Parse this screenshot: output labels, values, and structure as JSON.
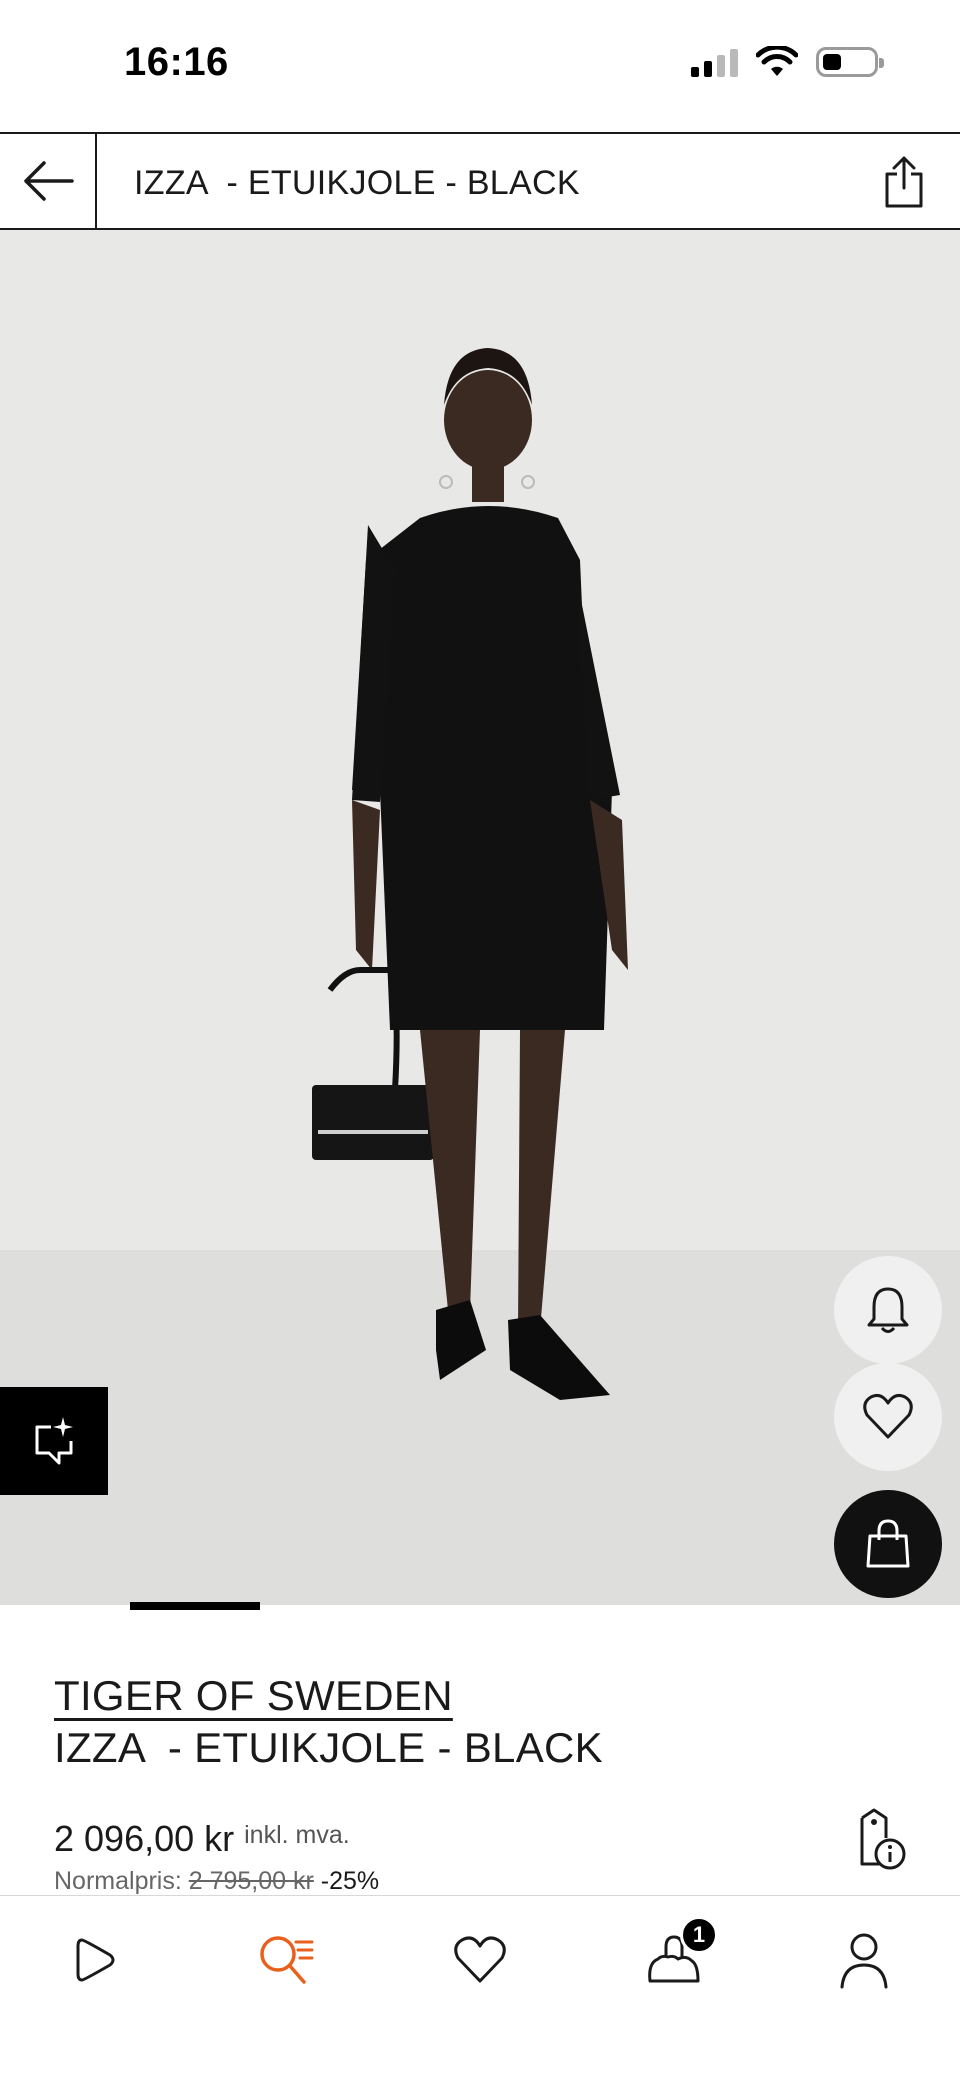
{
  "status_bar": {
    "time": "16:16",
    "icons": [
      "signal-icon",
      "wifi-icon",
      "battery-icon"
    ],
    "battery_level": 0.35
  },
  "header": {
    "back_icon": "arrow-left-icon",
    "title": "IZZA  - ETUIKJOLE - BLACK",
    "share_icon": "share-icon"
  },
  "product_image": {
    "alt": "IZZA  - ETUIKJOLE - BLACK",
    "carousel_position": 1,
    "carousel_total": 5,
    "actions": {
      "notify_icon": "bell-icon",
      "wishlist_icon": "heart-icon",
      "add_to_bag_icon": "shopping-bag-icon",
      "similar_icon": "similar-items-icon"
    }
  },
  "product": {
    "brand": "TIGER OF SWEDEN",
    "name": "IZZA  - ETUIKJOLE - BLACK",
    "price": "2 096,00 kr",
    "vat_note": "inkl. mva.",
    "normal_label": "Normalpris: ",
    "normal_price": "2 795,00 kr",
    "discount": " -25%",
    "price_info_icon": "price-tag-info-icon"
  },
  "bottom_nav": {
    "items": [
      {
        "icon": "play-icon",
        "name": "nav-play"
      },
      {
        "icon": "search-list-icon",
        "name": "nav-search",
        "active": true
      },
      {
        "icon": "heart-icon",
        "name": "nav-wishlist"
      },
      {
        "icon": "bag-icon",
        "name": "nav-bag",
        "badge": "1"
      },
      {
        "icon": "user-icon",
        "name": "nav-profile"
      }
    ]
  },
  "colors": {
    "accent": "#e8601c",
    "text": "#1a1a1a",
    "image_bg": "#e8e8e7"
  }
}
